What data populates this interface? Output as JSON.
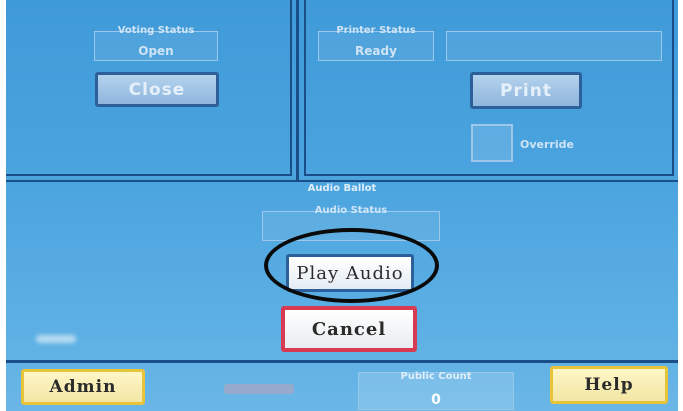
{
  "polls_panel": {
    "voting_status_label": "Voting Status",
    "voting_status_value": "Open",
    "close_button": "Close"
  },
  "print_panel": {
    "printer_status_label": "Printer Status",
    "printer_status_value": "Ready",
    "print_button": "Print",
    "override_label": "Override"
  },
  "audio_ballot": {
    "title": "Audio Ballot",
    "audio_status_label": "Audio Status",
    "play_audio_button": "Play Audio",
    "cancel_button": "Cancel"
  },
  "footer": {
    "admin_button": "Admin",
    "public_count_label": "Public Count",
    "public_count_value": "0",
    "help_button": "Help"
  },
  "colors": {
    "screen_blue": "#4aa3de",
    "border_navy": "#1a4e88",
    "cancel_red": "#d83a52",
    "footer_yellow": "#e8c43a"
  }
}
